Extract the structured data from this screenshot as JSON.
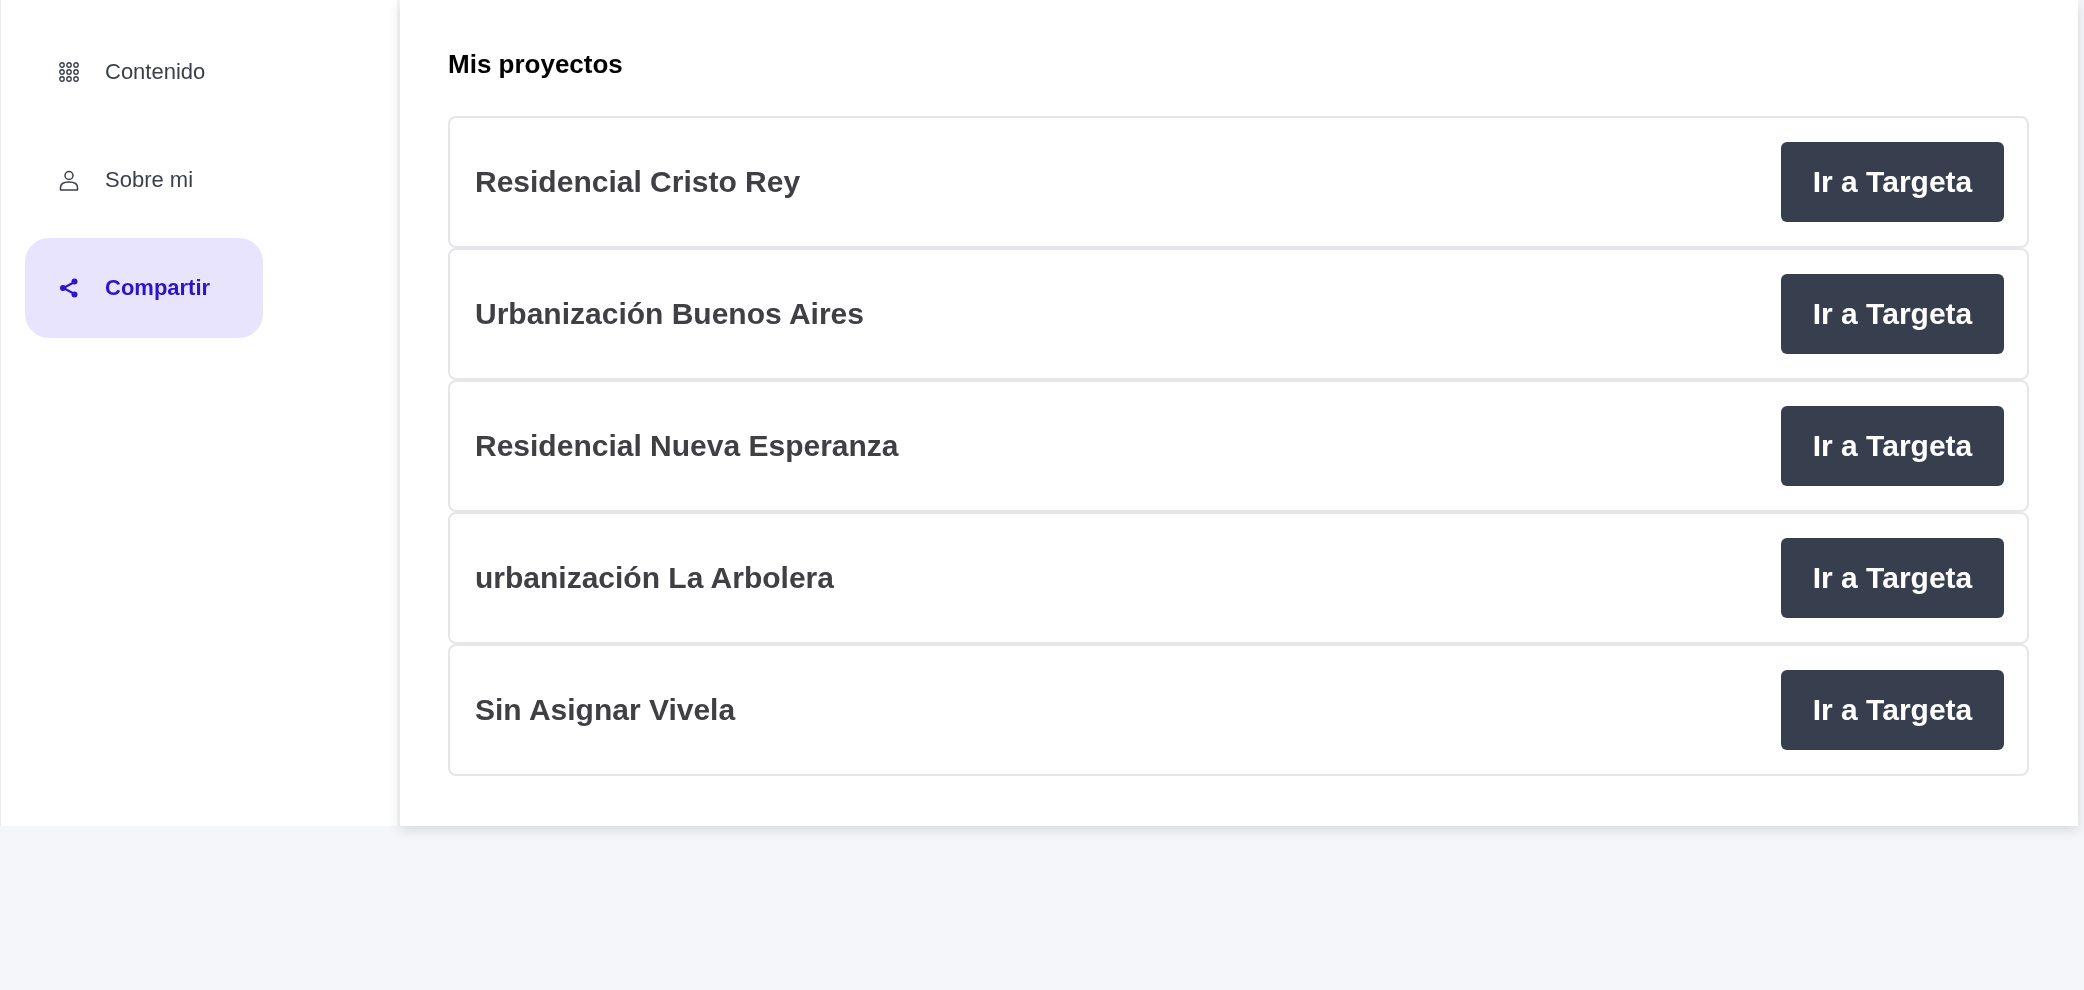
{
  "sidebar": {
    "items": [
      {
        "label": "Contenido",
        "selected": false
      },
      {
        "label": "Sobre mi",
        "selected": false
      },
      {
        "label": "Compartir",
        "selected": true
      }
    ]
  },
  "main": {
    "title": "Mis proyectos",
    "projects": [
      {
        "name": "Residencial Cristo Rey",
        "button": "Ir a Targeta"
      },
      {
        "name": "Urbanización Buenos Aires",
        "button": "Ir a Targeta"
      },
      {
        "name": "Residencial Nueva Esperanza",
        "button": "Ir a Targeta"
      },
      {
        "name": "urbanización La Arbolera",
        "button": "Ir a Targeta"
      },
      {
        "name": "Sin Asignar Vivela",
        "button": "Ir a Targeta"
      }
    ]
  }
}
